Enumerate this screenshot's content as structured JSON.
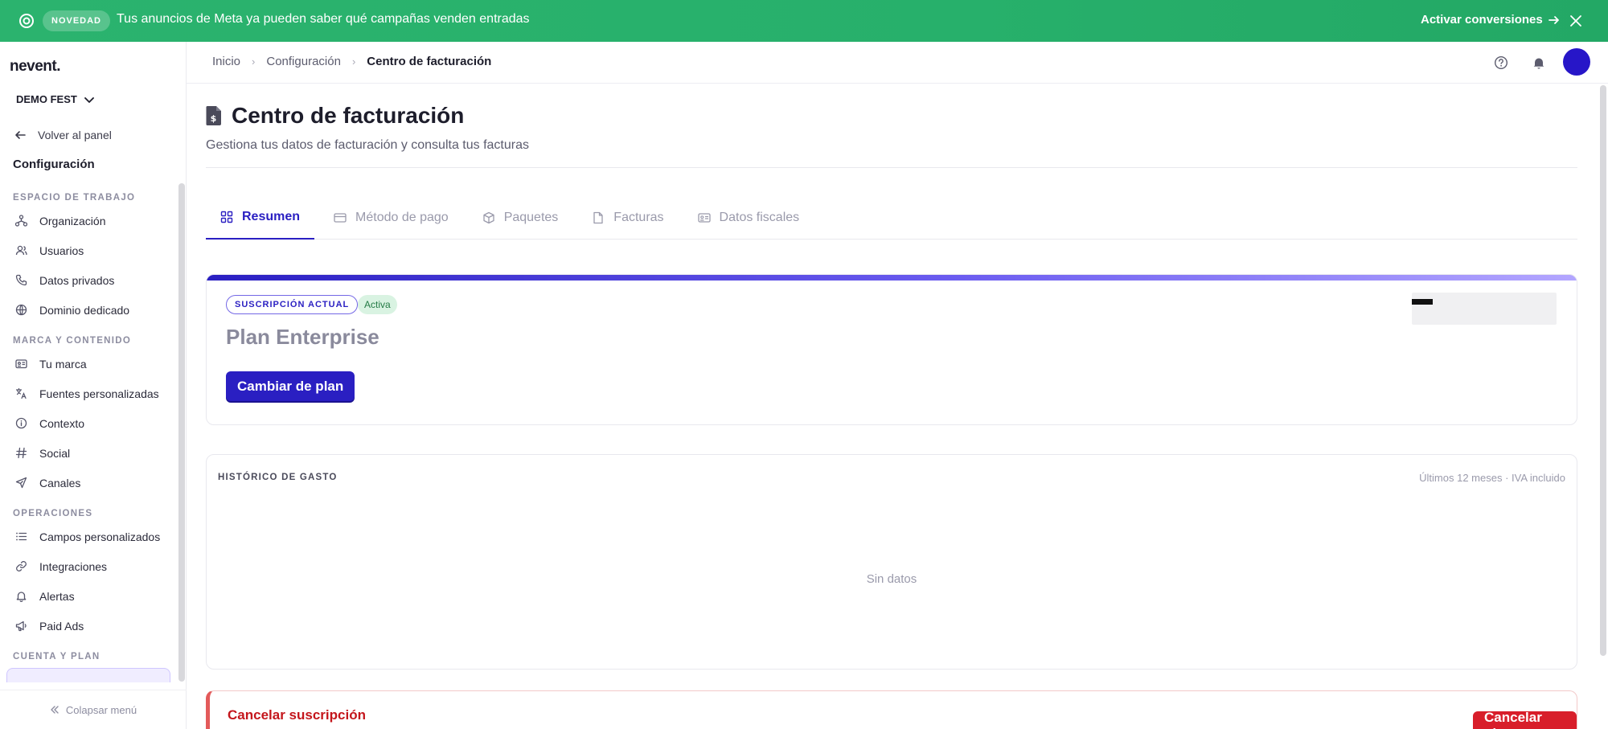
{
  "topbar": {
    "badge": "NOVEDAD",
    "announcement": "Tus anuncios de Meta ya pueden saber qué campañas venden entradas",
    "cta": "Activar conversiones",
    "bg_color": "#27b06b"
  },
  "sidebar": {
    "brand": "nevent.",
    "org": "DEMO FEST",
    "back": "Volver al panel",
    "title": "Configuración",
    "sections": {
      "workspace": "ESPACIO DE TRABAJO",
      "brand_content": "MARCA Y CONTENIDO",
      "operations": "OPERACIONES",
      "account": "CUENTA Y PLAN"
    },
    "items": {
      "organizacion": "Organización",
      "usuarios": "Usuarios",
      "datos_privados": "Datos privados",
      "dominio": "Dominio dedicado",
      "tu_marca": "Tu marca",
      "fuentes": "Fuentes personalizadas",
      "contexto": "Contexto",
      "social": "Social",
      "canales": "Canales",
      "campos": "Campos personalizados",
      "integraciones": "Integraciones",
      "alertas": "Alertas",
      "paid_ads": "Paid Ads"
    },
    "collapse": "Colapsar menú"
  },
  "header": {
    "breadcrumb": [
      "Inicio",
      "Configuración",
      "Centro de facturación"
    ],
    "avatar_color": "#2716c8"
  },
  "page": {
    "title": "Centro de facturación",
    "subtitle": "Gestiona tus datos de facturación y consulta tus facturas"
  },
  "tabs": [
    "Resumen",
    "Método de pago",
    "Paquetes",
    "Facturas",
    "Datos fiscales"
  ],
  "plan": {
    "label": "SUSCRIPCIÓN ACTUAL",
    "status": "Activa",
    "name": "Plan Enterprise",
    "change_button": "Cambiar de plan",
    "accent_color": "#2a1fc2"
  },
  "spend": {
    "title": "HISTÓRICO DE GASTO",
    "meta": "Últimos 12 meses · IVA incluido",
    "empty": "Sin datos"
  },
  "cancel": {
    "title": "Cancelar suscripción",
    "button": "Cancelar plan",
    "danger_color": "#d81e2a"
  }
}
